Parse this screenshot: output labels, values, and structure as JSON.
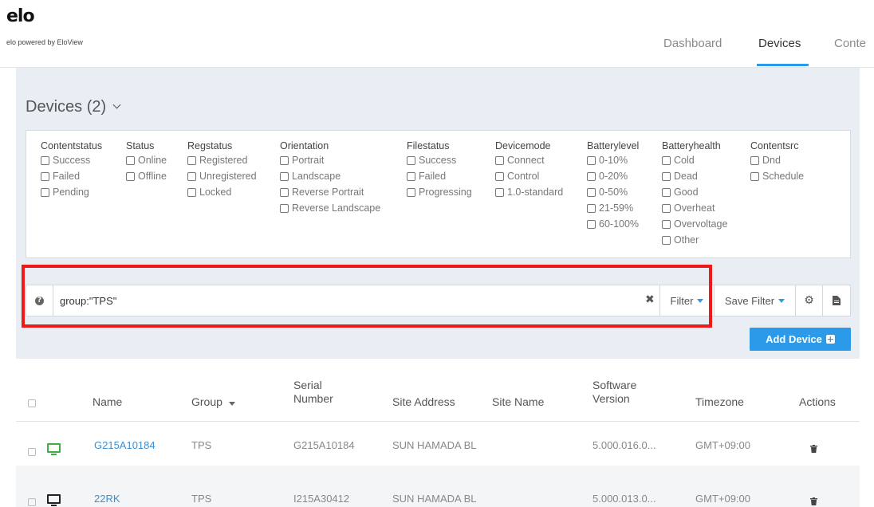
{
  "header": {
    "logo": "elo",
    "tagline": "elo powered by EloView",
    "nav": [
      "Dashboard",
      "Devices",
      "Conte"
    ],
    "active_nav": "Devices",
    "accent_color": "#2b9ae8"
  },
  "devices": {
    "title": "Devices (2)"
  },
  "filters": [
    {
      "label": "Contentstatus",
      "options": [
        "Success",
        "Failed",
        "Pending"
      ]
    },
    {
      "label": "Status",
      "options": [
        "Online",
        "Offline"
      ]
    },
    {
      "label": "Regstatus",
      "options": [
        "Registered",
        "Unregistered",
        "Locked"
      ]
    },
    {
      "label": "Orientation",
      "options": [
        "Portrait",
        "Landscape",
        "Reverse Portrait",
        "Reverse Landscape"
      ]
    },
    {
      "label": "Filestatus",
      "options": [
        "Success",
        "Failed",
        "Progressing"
      ]
    },
    {
      "label": "Devicemode",
      "options": [
        "Connect",
        "Control",
        "1.0-standard"
      ]
    },
    {
      "label": "Batterylevel",
      "options": [
        "0-10%",
        "0-20%",
        "0-50%",
        "21-59%",
        "60-100%"
      ]
    },
    {
      "label": "Batteryhealth",
      "options": [
        "Cold",
        "Dead",
        "Good",
        "Overheat",
        "Overvoltage",
        "Other"
      ]
    },
    {
      "label": "Contentsrc",
      "options": [
        "Dnd",
        "Schedule"
      ]
    }
  ],
  "search": {
    "value": "group:\"TPS\"",
    "help_icon": "question-circle-icon",
    "clear_icon": "times-icon",
    "filter_label": "Filter",
    "save_filter_label": "Save Filter",
    "settings_icon": "gear-icon",
    "export_icon": "file-icon",
    "highlight_color": "#ee1a1a"
  },
  "add_device_label": "Add Device",
  "table": {
    "columns": {
      "name": "Name",
      "group": "Group",
      "serial": "Serial\nNumber",
      "site_address": "Site Address",
      "site_name": "Site Name",
      "software": "Software\nVersion",
      "timezone": "Timezone",
      "actions": "Actions"
    },
    "rows": [
      {
        "status_color": "#3cb043",
        "name": "G215A10184",
        "group": "TPS",
        "serial": "G215A10184",
        "site_address": "SUN HAMADA BL",
        "site_name": "",
        "software": "5.000.016.0...",
        "timezone": "GMT+09:00"
      },
      {
        "status_color": "#222222",
        "name": "22RK",
        "group": "TPS",
        "serial": "I215A30412",
        "site_address": "SUN HAMADA BL",
        "site_name": "",
        "software": "5.000.013.0...",
        "timezone": "GMT+09:00"
      }
    ]
  }
}
